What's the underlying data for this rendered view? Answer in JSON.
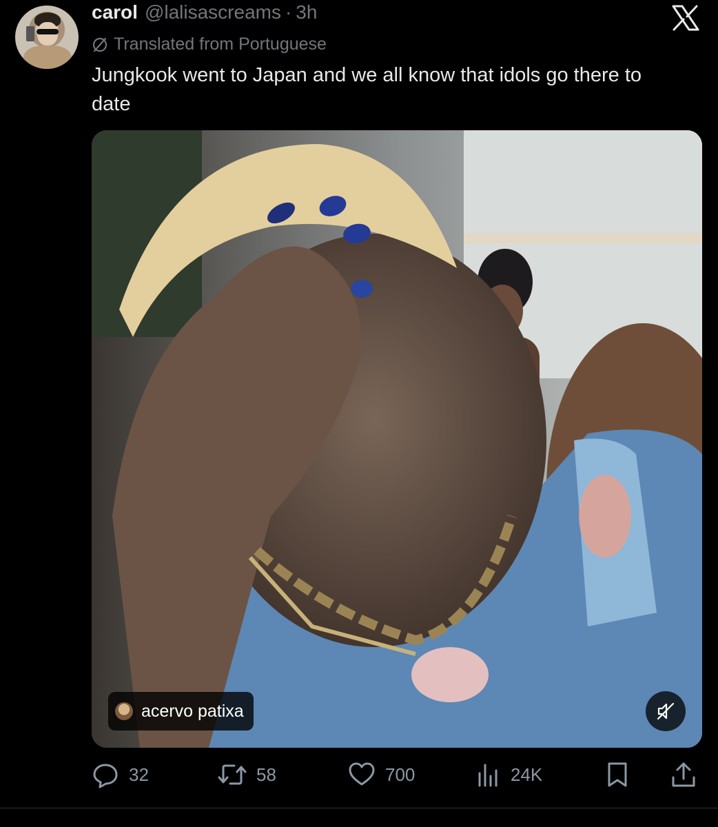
{
  "author": {
    "display_name": "carol",
    "handle": "@lalisascreams",
    "separator": "·",
    "timestamp": "3h"
  },
  "translation_note": "Translated from Portuguese",
  "tweet_text": "Jungkook went to Japan and we all know that idols go there to date",
  "media": {
    "source_label": "acervo patixa",
    "icons": [
      "muted-speaker-icon"
    ]
  },
  "actions": {
    "replies": "32",
    "retweets": "58",
    "likes": "700",
    "views": "24K"
  },
  "icons": [
    "globe-slash-icon",
    "x-logo",
    "reply-icon",
    "retweet-icon",
    "heart-icon",
    "views-icon",
    "bookmark-icon",
    "share-icon"
  ],
  "colors": {
    "background": "#000000",
    "text_primary": "#e7e9ea",
    "text_secondary": "#71767b",
    "action_gray": "#8b98a5"
  }
}
